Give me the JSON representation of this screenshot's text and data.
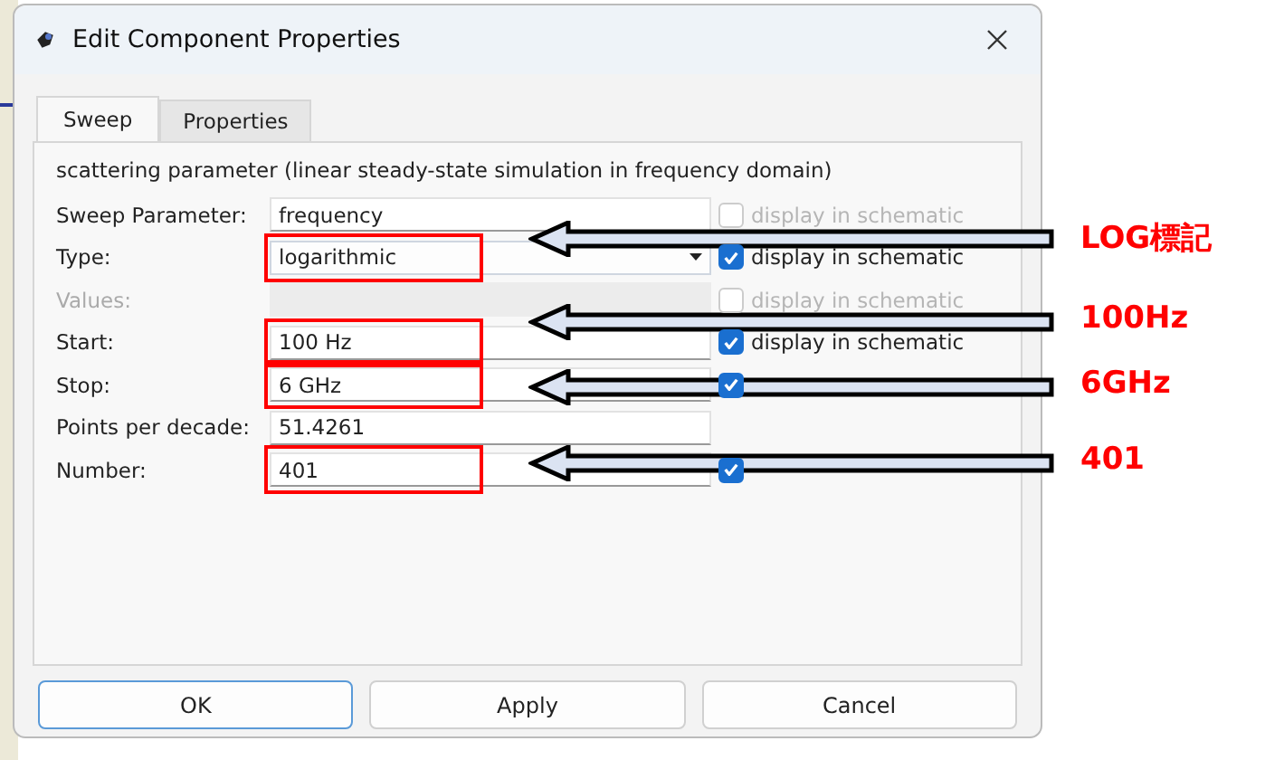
{
  "window": {
    "title": "Edit Component Properties"
  },
  "tabs": [
    {
      "label": "Sweep",
      "selected": true
    },
    {
      "label": "Properties",
      "selected": false
    }
  ],
  "description": "scattering parameter (linear steady-state simulation in frequency domain)",
  "rows": [
    {
      "kind": "field",
      "label": "Sweep Parameter:",
      "value": "frequency",
      "disabled": false,
      "highlighted": false,
      "checkbox": {
        "label": "display in schematic",
        "checked": false,
        "disabled": true
      }
    },
    {
      "kind": "dropdown",
      "label": "Type:",
      "value": "logarithmic",
      "disabled": false,
      "highlighted": true,
      "annotation": "LOG標記",
      "checkbox": {
        "label": "display in schematic",
        "checked": true,
        "disabled": false
      }
    },
    {
      "kind": "field",
      "label": "Values:",
      "value": "",
      "disabled": true,
      "highlighted": false,
      "checkbox": {
        "label": "display in schematic",
        "checked": false,
        "disabled": true
      }
    },
    {
      "kind": "field",
      "label": "Start:",
      "value": "100 Hz",
      "disabled": false,
      "highlighted": true,
      "annotation": "100Hz",
      "checkbox": {
        "label": "display in schematic",
        "checked": true,
        "disabled": false
      }
    },
    {
      "kind": "field",
      "label": "Stop:",
      "value": "6 GHz",
      "disabled": false,
      "highlighted": true,
      "annotation": "6GHz",
      "checkbox": {
        "checked": true,
        "disabled": false
      }
    },
    {
      "kind": "field",
      "label": "Points per decade:",
      "value": "51.4261",
      "disabled": false,
      "highlighted": false
    },
    {
      "kind": "field",
      "label": "Number:",
      "value": "401",
      "disabled": false,
      "highlighted": true,
      "annotation": "401",
      "checkbox": {
        "checked": true,
        "disabled": false
      }
    }
  ],
  "buttons": [
    {
      "label": "OK",
      "default": true
    },
    {
      "label": "Apply",
      "default": false
    },
    {
      "label": "Cancel",
      "default": false
    }
  ]
}
